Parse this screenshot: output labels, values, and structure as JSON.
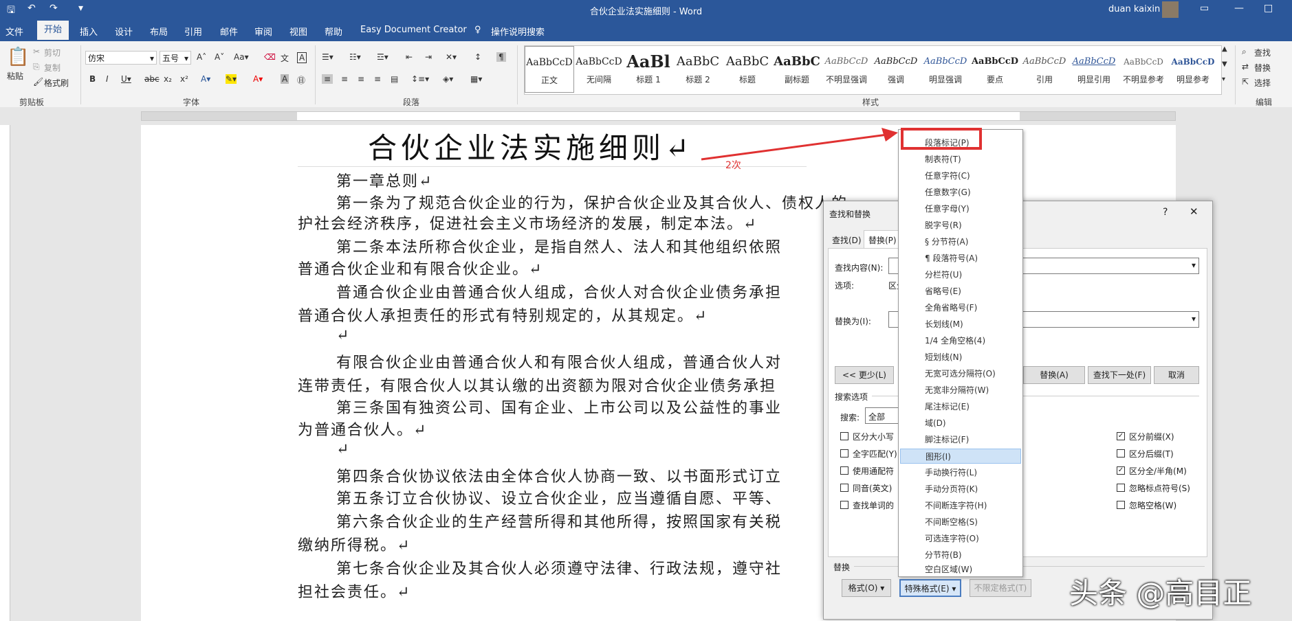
{
  "window": {
    "title": "合伙企业法实施细则 - Word",
    "user": "duan kaixin",
    "controls": [
      "□",
      "—",
      "□"
    ]
  },
  "menu_tabs": [
    "文件",
    "开始",
    "插入",
    "设计",
    "布局",
    "引用",
    "邮件",
    "审阅",
    "视图",
    "帮助",
    "Easy Document Creator",
    "操作说明搜索"
  ],
  "ribbon": {
    "clipboard": {
      "paste": "粘贴",
      "cut": "剪切",
      "copy": "复制",
      "format_painter": "格式刷",
      "label": "剪贴板"
    },
    "font": {
      "family": "仿宋",
      "size": "五号",
      "label": "字体"
    },
    "paragraph": {
      "label": "段落"
    },
    "styles": {
      "label": "样式",
      "items": [
        {
          "preview": "AaBbCcD",
          "name": "正文"
        },
        {
          "preview": "AaBbCcD",
          "name": "无间隔"
        },
        {
          "preview": "AaBl",
          "name": "标题 1"
        },
        {
          "preview": "AaBbC",
          "name": "标题 2"
        },
        {
          "preview": "AaBbC",
          "name": "标题"
        },
        {
          "preview": "AaBbC",
          "name": "副标题"
        },
        {
          "preview": "AaBbCcD",
          "name": "不明显强调"
        },
        {
          "preview": "AaBbCcD",
          "name": "强调"
        },
        {
          "preview": "AaBbCcD",
          "name": "明显强调"
        },
        {
          "preview": "AaBbCcD",
          "name": "要点"
        },
        {
          "preview": "AaBbCcD",
          "name": "引用"
        },
        {
          "preview": "AaBbCcD",
          "name": "明显引用"
        },
        {
          "preview": "AaBbCcD",
          "name": "不明显参考"
        },
        {
          "preview": "AaBbCcD",
          "name": "明显参考"
        }
      ]
    },
    "editing": {
      "find": "查找",
      "replace": "替换",
      "select": "选择",
      "label": "编辑"
    }
  },
  "document": {
    "title": "合伙企业法实施细则↵",
    "lines": [
      "第一章总则↵",
      "第一条为了规范合伙企业的行为，保护合伙企业及其合伙人、债权人的",
      "护社会经济秩序，促进社会主义市场经济的发展，制定本法。↵",
      "第二条本法所称合伙企业，是指自然人、法人和其他组织依照",
      "普通合伙企业和有限合伙企业。↵",
      "普通合伙企业由普通合伙人组成，合伙人对合伙企业债务承担",
      "普通合伙人承担责任的形式有特别规定的，从其规定。↵",
      "↵",
      "有限合伙企业由普通合伙人和有限合伙人组成，普通合伙人对",
      "连带责任，有限合伙人以其认缴的出资额为限对合伙企业债务承担",
      "第三条国有独资公司、国有企业、上市公司以及公益性的事业",
      "为普通合伙人。↵",
      "↵",
      "第四条合伙协议依法由全体合伙人协商一致、以书面形式订立",
      "第五条订立合伙协议、设立合伙企业，应当遵循自愿、平等、",
      "第六条合伙企业的生产经营所得和其他所得，按照国家有关税",
      "缴纳所得税。↵",
      "第七条合伙企业及其合伙人必须遵守法律、行政法规，遵守社",
      "担社会责任。↵"
    ]
  },
  "dialog": {
    "title": "查找和替换",
    "help": "?",
    "close": "✕",
    "tabs": [
      "查找(D)",
      "替换(P)"
    ],
    "find_label": "查找内容(N):",
    "options_label": "选项:",
    "options_value": "区分",
    "replace_label": "替换为(I):",
    "less_button": "<< 更少(L)",
    "replace_all_button": "替换(A)",
    "find_next_button": "查找下一处(F)",
    "cancel_button": "取消",
    "search_options_label": "搜索选项",
    "search_label": "搜索:",
    "search_value": "全部",
    "left_checks": [
      {
        "label": "区分大小写",
        "checked": false
      },
      {
        "label": "全字匹配(Y)",
        "checked": false
      },
      {
        "label": "使用通配符",
        "checked": false
      },
      {
        "label": "同音(英文)",
        "checked": false
      },
      {
        "label": "查找单词的",
        "checked": false
      }
    ],
    "right_checks": [
      {
        "label": "区分前缀(X)",
        "checked": true
      },
      {
        "label": "区分后缀(T)",
        "checked": false
      },
      {
        "label": "区分全/半角(M)",
        "checked": true
      },
      {
        "label": "忽略标点符号(S)",
        "checked": false
      },
      {
        "label": "忽略空格(W)",
        "checked": false
      }
    ],
    "replace_section_label": "替换",
    "format_button": "格式(O) ▾",
    "special_button": "特殊格式(E) ▾",
    "no_format_button": "不限定格式(T)"
  },
  "special_menu": {
    "items": [
      "段落标记(P)",
      "制表符(T)",
      "任意字符(C)",
      "任意数字(G)",
      "任意字母(Y)",
      "脱字号(R)",
      "§ 分节符(A)",
      "¶ 段落符号(A)",
      "分栏符(U)",
      "省略号(E)",
      "全角省略号(F)",
      "长划线(M)",
      "1/4 全角空格(4)",
      "短划线(N)",
      "无宽可选分隔符(O)",
      "无宽非分隔符(W)",
      "尾注标记(E)",
      "域(D)",
      "脚注标记(F)",
      "图形(I)",
      "手动换行符(L)",
      "手动分页符(K)",
      "不间断连字符(H)",
      "不间断空格(S)",
      "可选连字符(O)",
      "分节符(B)",
      "空白区域(W)"
    ],
    "highlighted_index": 19
  },
  "annotation": {
    "label": "2次",
    "color": "#e03131"
  },
  "watermark": "头条 @高目正",
  "colors": {
    "brand": "#2b579a",
    "annotation": "#e03131"
  }
}
